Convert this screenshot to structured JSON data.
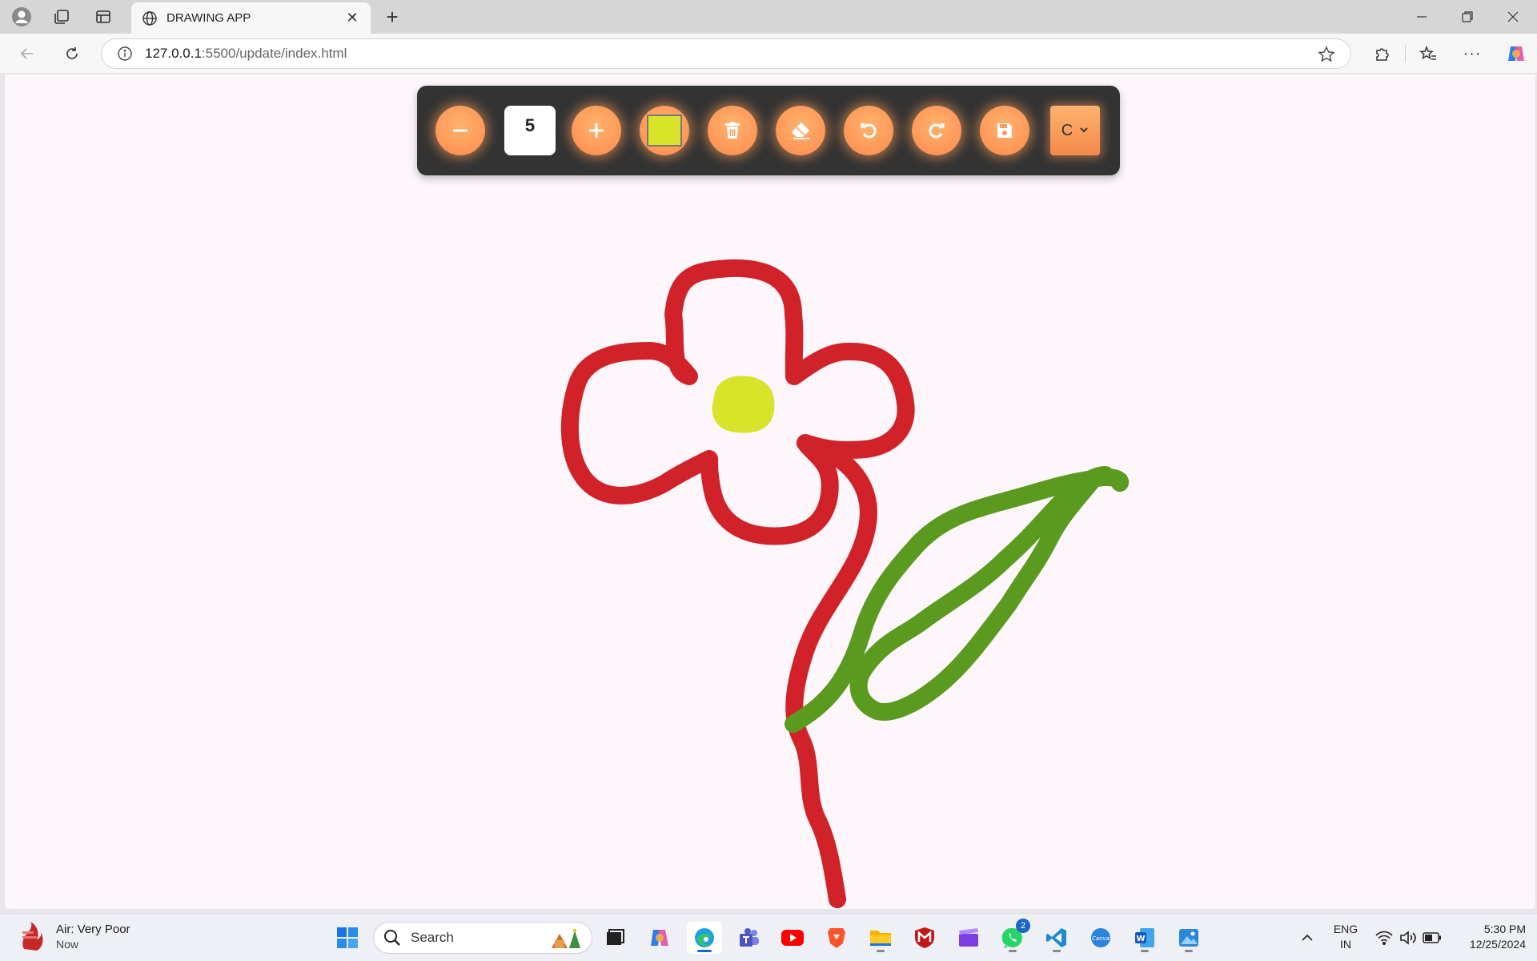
{
  "browser": {
    "tab_title": "DRAWING APP",
    "url_host": "127.0.0.1",
    "url_path": ":5500/update/index.html"
  },
  "toolbar": {
    "brush_size": "5",
    "current_color": "#d8e32a",
    "select_value": "C",
    "buttons": [
      "decrease-size",
      "increase-size",
      "color-picker",
      "clear",
      "eraser",
      "undo",
      "redo",
      "save"
    ]
  },
  "drawing": {
    "strokes": [
      {
        "part": "petals",
        "color": "#d1222a"
      },
      {
        "part": "stem",
        "color": "#d1222a"
      },
      {
        "part": "center",
        "color": "#d8e32a"
      },
      {
        "part": "leaf",
        "color": "#5a9a1f"
      }
    ]
  },
  "taskbar": {
    "weather_title": "Air: Very Poor",
    "weather_sub": "Now",
    "search_placeholder": "Search",
    "whatsapp_badge": "2",
    "lang_line1": "ENG",
    "lang_line2": "IN",
    "time": "5:30 PM",
    "date": "12/25/2024"
  },
  "colors": {
    "accent": "#ff9a5a",
    "toolbar_bg": "#333333",
    "page_bg": "#fdf6fb"
  }
}
